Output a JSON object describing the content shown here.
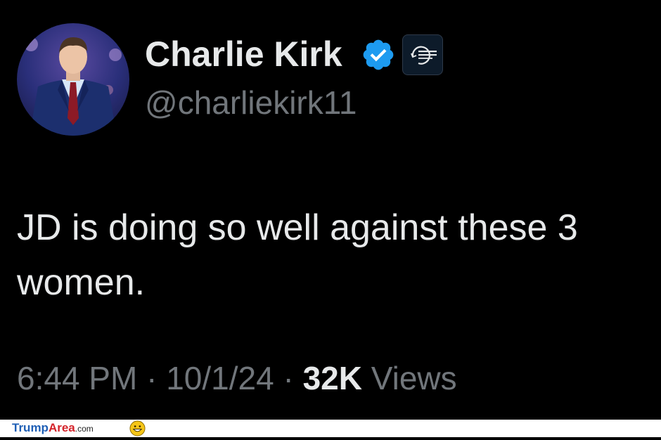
{
  "tweet": {
    "display_name": "Charlie Kirk",
    "handle": "@charliekirk11",
    "verified_icon": "verified-check-icon",
    "org_badge": {
      "text": "TURNING POINT USA",
      "icon": "turning-point-usa-logo"
    },
    "text": "JD is doing so well against these 3 women.",
    "time": "6:44 PM",
    "date": "10/1/24",
    "views_count": "32K",
    "views_label": "Views",
    "separator": "·"
  },
  "footer": {
    "site_part1": "Trump",
    "site_part2": "Area",
    "site_part3": ".com",
    "icon": "grinning-face-icon"
  },
  "colors": {
    "background": "#000000",
    "primary_text": "#e7e9ea",
    "secondary_text": "#71767b",
    "verified_blue": "#1d9bf0"
  }
}
